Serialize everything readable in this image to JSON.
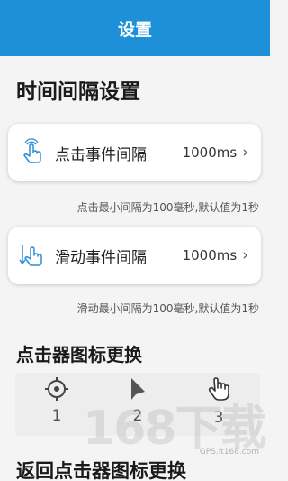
{
  "header": {
    "title": "设置"
  },
  "interval_section": {
    "title": "时间间隔设置"
  },
  "click_setting": {
    "label": "点击事件间隔",
    "value": "1000ms",
    "chevron": "›",
    "note": "点击最小间隔为100毫秒,默认值为1秒",
    "icon": "tap-hand-icon"
  },
  "swipe_setting": {
    "label": "滑动事件间隔",
    "value": "1000ms",
    "chevron": "›",
    "note": "滑动最小间隔为100毫秒,默认值为1秒",
    "icon": "swipe-hand-icon"
  },
  "clicker_icon_section": {
    "title": "点击器图标更换",
    "options": [
      {
        "number": "1",
        "icon": "crosshair-icon"
      },
      {
        "number": "2",
        "icon": "arrow-cursor-icon"
      },
      {
        "number": "3",
        "icon": "hand-cursor-icon"
      }
    ]
  },
  "next_section": {
    "title": "返回点击器图标更换"
  },
  "watermark": {
    "big": "168下载",
    "small": "GPS.it168.com"
  },
  "colors": {
    "header_bg": "#1e90d8",
    "accent_icon": "#2b8fd6"
  }
}
